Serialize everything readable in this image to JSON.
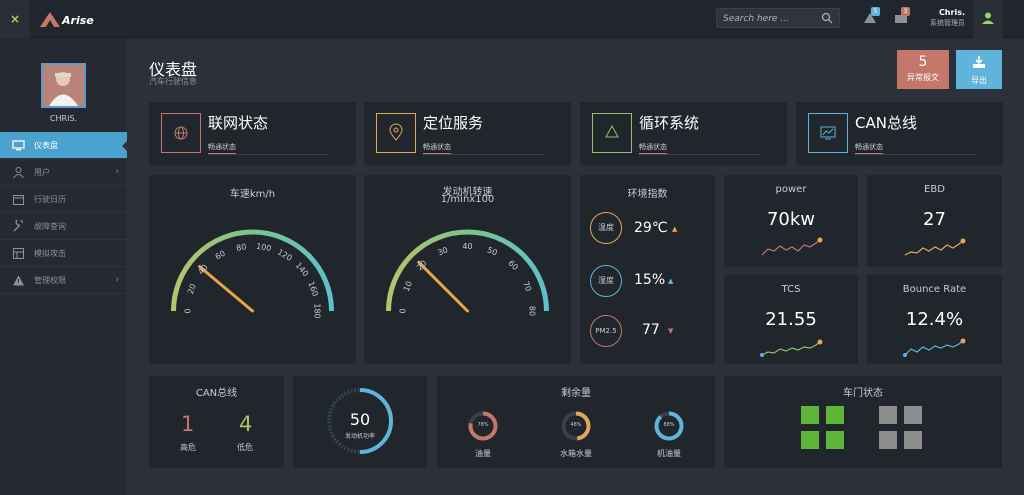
{
  "topbar": {
    "close_label": "×",
    "logo_text": "Arise",
    "search_placeholder": "Search here ...",
    "badge_a": "5",
    "badge_b": "3",
    "user_name": "Chris.",
    "user_role": "系统管理员"
  },
  "sidebar": {
    "profile_name": "CHRIS.",
    "items": [
      {
        "label": "仪表盘",
        "icon": "monitor-icon"
      },
      {
        "label": "用户",
        "icon": "user-icon"
      },
      {
        "label": "行驶日历",
        "icon": "calendar-icon"
      },
      {
        "label": "故障查询",
        "icon": "wrench-icon"
      },
      {
        "label": "模拟攻击",
        "icon": "layout-icon"
      },
      {
        "label": "管理权限",
        "icon": "warning-icon"
      }
    ]
  },
  "header": {
    "title": "仪表盘",
    "subtitle": "汽车行驶信息",
    "abnormal_count": "5",
    "abnormal_label": "异常报文",
    "export_label": "导出"
  },
  "stats": [
    {
      "title": "联网状态",
      "tag": "畅通状态",
      "color": "#c3776b",
      "icon": "globe-icon"
    },
    {
      "title": "定位服务",
      "tag": "畅通状态",
      "color": "#e0a95a",
      "icon": "location-icon"
    },
    {
      "title": "循环系统",
      "tag": "畅通状态",
      "color": "#8fc06a",
      "icon": "recycle-icon"
    },
    {
      "title": "CAN总线",
      "tag": "畅通状态",
      "color": "#5fb4db",
      "icon": "chart-icon"
    }
  ],
  "gauges": {
    "speed": {
      "title": "车速km/h",
      "ticks": [
        "0",
        "20",
        "40",
        "60",
        "80",
        "100",
        "120",
        "140",
        "160",
        "180"
      ],
      "value": 40
    },
    "rpm": {
      "title": "发动机转速",
      "subtitle": "1/minx100",
      "ticks": [
        "0",
        "10",
        "20",
        "30",
        "40",
        "50",
        "60",
        "70",
        "80"
      ],
      "value": 20
    }
  },
  "env": {
    "title": "环境指数",
    "items": [
      {
        "label": "温度",
        "value": "29℃",
        "trend": "▲",
        "color": "#e0a95a",
        "arrow": "#e0a95a"
      },
      {
        "label": "湿度",
        "value": "15%",
        "trend": "▲",
        "color": "#5fb4db",
        "arrow": "#5fb4db"
      },
      {
        "label": "PM2.5",
        "value": "77",
        "trend": "▼",
        "color": "#c3776b",
        "arrow": "#c3776b"
      }
    ]
  },
  "metrics": [
    {
      "title": "power",
      "value": "70kw",
      "color": "#c3776b"
    },
    {
      "title": "EBD",
      "value": "27",
      "color": "#e0a95a"
    },
    {
      "title": "TCS",
      "value": "21.55",
      "color": "#8fc06a"
    },
    {
      "title": "Bounce Rate",
      "value": "12.4%",
      "color": "#5fb4db"
    }
  ],
  "can": {
    "title": "CAN总线",
    "high": "1",
    "high_label": "高危",
    "low": "4",
    "low_label": "低危"
  },
  "engine_power": {
    "value": "50",
    "label": "发动机功率",
    "percent": 50
  },
  "remain": {
    "title": "剩余量",
    "items": [
      {
        "label": "油量",
        "pct": "78%",
        "value": 0.78,
        "color": "#c3776b"
      },
      {
        "label": "水箱水量",
        "pct": "48%",
        "value": 0.48,
        "color": "#e0a95a"
      },
      {
        "label": "机油量",
        "pct": "88%",
        "value": 0.88,
        "color": "#5fb4db"
      }
    ]
  },
  "doors": {
    "title": "车门状态",
    "left_color": "#5fb53a",
    "right_color": "#8c8c8c"
  }
}
